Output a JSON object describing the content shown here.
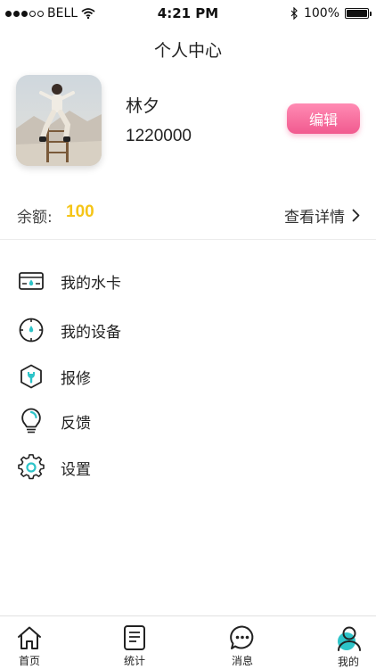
{
  "status_bar": {
    "carrier": "BELL",
    "time": "4:21 PM",
    "battery": "100%"
  },
  "header": {
    "title": "个人中心"
  },
  "profile": {
    "name": "林夕",
    "id": "1220000",
    "edit_label": "编辑"
  },
  "balance": {
    "label": "余额:",
    "value": "100",
    "detail_label": "查看详情"
  },
  "menu": {
    "items": [
      {
        "label": "我的水卡",
        "icon": "water-card-icon"
      },
      {
        "label": "我的设备",
        "icon": "device-icon"
      },
      {
        "label": "报修",
        "icon": "repair-icon"
      },
      {
        "label": "反馈",
        "icon": "feedback-bulb-icon"
      },
      {
        "label": "设置",
        "icon": "gear-icon"
      }
    ]
  },
  "tab_bar": {
    "tabs": [
      {
        "label": "首页",
        "icon": "home-icon"
      },
      {
        "label": "统计",
        "icon": "document-icon"
      },
      {
        "label": "消息",
        "icon": "message-icon"
      },
      {
        "label": "我的",
        "icon": "user-icon",
        "active": true
      }
    ]
  },
  "colors": {
    "accent": "#2ec4c9",
    "balance": "#f5c518",
    "edit_button": "#f15a8f"
  }
}
